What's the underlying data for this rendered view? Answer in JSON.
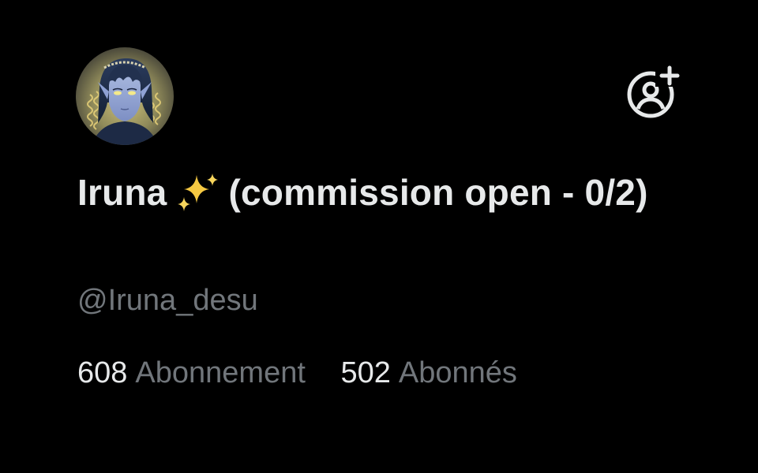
{
  "profile": {
    "display_name_prefix": "Iruna",
    "display_name_suffix": "(commission open - 0/2)",
    "name_emoji_icon": "sparkles-icon",
    "handle": "@Iruna_desu",
    "avatar_icon": "avatar-illustration",
    "follow_icon": "follow-person-plus-icon"
  },
  "stats": {
    "following_count": "608",
    "following_label": "Abonnement",
    "followers_count": "502",
    "followers_label": "Abonnés"
  },
  "colors": {
    "background": "#000000",
    "primary_text": "#e7e9ea",
    "secondary_text": "#71767b",
    "sparkle": "#f5c842"
  }
}
